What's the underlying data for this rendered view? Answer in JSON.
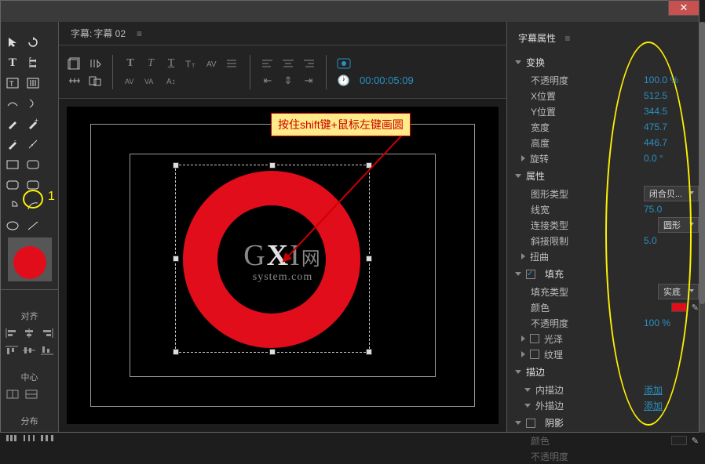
{
  "window": {
    "close_label": "✕"
  },
  "editor": {
    "header_prefix": "字幕:",
    "header_name": "字幕 02",
    "menu_icon": "≡",
    "timecode": "00:00:05:09"
  },
  "annotation": {
    "text": "按住shift键+鼠标左键画圆"
  },
  "tools": {
    "sections": {
      "align": "对齐",
      "center": "中心",
      "distribute": "分布"
    },
    "highlight_number": "1"
  },
  "watermark": {
    "main_a": "G",
    "main_b": "X",
    "main_c": "I",
    "suffix": "网",
    "sub": "system.com"
  },
  "props": {
    "title": "字幕属性",
    "menu_icon": "≡",
    "transform": {
      "label": "变换",
      "opacity_label": "不透明度",
      "opacity_value": "100.0 %",
      "x_label": "X位置",
      "x_value": "512.5",
      "y_label": "Y位置",
      "y_value": "344.5",
      "width_label": "宽度",
      "width_value": "475.7",
      "height_label": "高度",
      "height_value": "446.7",
      "rotation_label": "旋转",
      "rotation_value": "0.0 °"
    },
    "attributes": {
      "label": "属性",
      "shape_type_label": "图形类型",
      "shape_type_value": "闭合贝...",
      "line_width_label": "线宽",
      "line_width_value": "75.0",
      "join_type_label": "连接类型",
      "join_type_value": "圆形",
      "miter_label": "斜接限制",
      "miter_value": "5.0",
      "distort_label": "扭曲"
    },
    "fill": {
      "label": "填充",
      "fill_type_label": "填充类型",
      "fill_type_value": "实底",
      "color_label": "颜色",
      "opacity_label": "不透明度",
      "opacity_value": "100 %",
      "sheen_label": "光泽",
      "texture_label": "纹理"
    },
    "stroke": {
      "label": "描边",
      "inner_label": "内描边",
      "outer_label": "外描边",
      "add_label": "添加"
    },
    "shadow": {
      "label": "阴影",
      "color_label": "颜色",
      "opacity_label": "不透明度"
    }
  }
}
